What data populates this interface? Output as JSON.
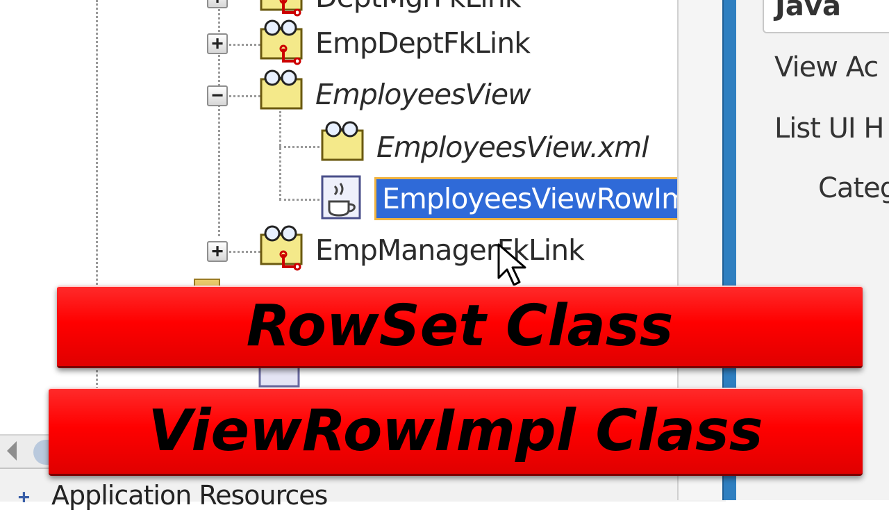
{
  "tree": {
    "nodes": [
      {
        "label": "DeptMgrFkLink",
        "expander": "+",
        "italic": false,
        "selected": false
      },
      {
        "label": "EmpDeptFkLink",
        "expander": "+",
        "italic": false,
        "selected": false
      },
      {
        "label": "EmployeesView",
        "expander": "−",
        "italic": true,
        "selected": false
      },
      {
        "label": "EmployeesView.xml",
        "expander": "",
        "italic": true,
        "selected": false
      },
      {
        "label": "EmployeesViewRowImpl.java",
        "expander": "",
        "italic": false,
        "selected": true
      },
      {
        "label": "EmpManagerFkLink",
        "expander": "+",
        "italic": false,
        "selected": false
      }
    ]
  },
  "bottom": {
    "expander": "+",
    "label": "Application Resources"
  },
  "properties": {
    "java_value": "Java",
    "labels": [
      "View Ac",
      "List UI H",
      "Categ"
    ]
  },
  "banners": {
    "rowset": "RowSet Class",
    "viewrowimpl": "ViewRowImpl Class"
  },
  "colors": {
    "banner_red": "#ff0000",
    "selection_blue": "#2f6ad8",
    "selection_outline": "#f0b340"
  }
}
